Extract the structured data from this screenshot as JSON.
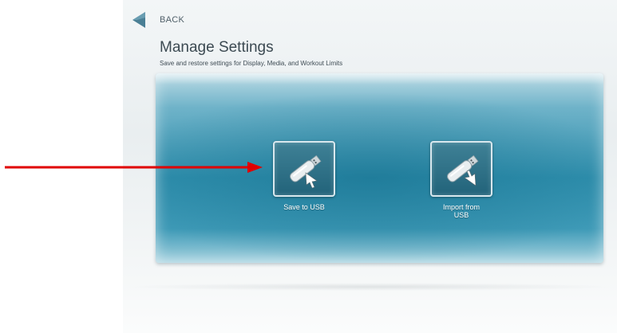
{
  "header": {
    "back_label": "BACK",
    "title": "Manage Settings",
    "subtitle": "Save and restore settings for Display, Media, and Workout Limits"
  },
  "actions": {
    "save": {
      "label": "Save to USB",
      "icon": "usb-drive-save-icon"
    },
    "import": {
      "label_line1": "Import from",
      "label_line2": "USB",
      "icon": "usb-drive-import-icon"
    }
  },
  "colors": {
    "panel_blue": "#2f8fad",
    "tile_bg": "#22637a",
    "annotation_arrow": "#e00000",
    "back_arrow": "#4a7f95"
  }
}
